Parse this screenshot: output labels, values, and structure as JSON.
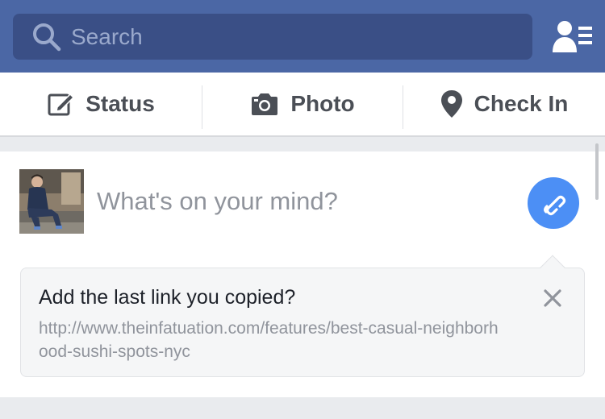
{
  "search": {
    "placeholder": "Search",
    "icon": "search-icon"
  },
  "header": {
    "friends_icon": "friend-requests-icon"
  },
  "actions": [
    {
      "label": "Status",
      "icon": "edit-icon"
    },
    {
      "label": "Photo",
      "icon": "camera-icon"
    },
    {
      "label": "Check In",
      "icon": "location-pin-icon"
    }
  ],
  "composer": {
    "prompt": "What's on your mind?",
    "link_icon": "link-icon"
  },
  "link_suggestion": {
    "title": "Add the last link you copied?",
    "url": "http://www.theinfatuation.com/features/best-casual-neighborhood-sushi-spots-nyc",
    "close_icon": "close-icon"
  },
  "colors": {
    "header_blue": "#4b67a5",
    "search_bg": "#3a4f86",
    "link_button_blue": "#4c8ff5",
    "text_dark": "#4b4f56",
    "text_muted": "#90949c"
  }
}
